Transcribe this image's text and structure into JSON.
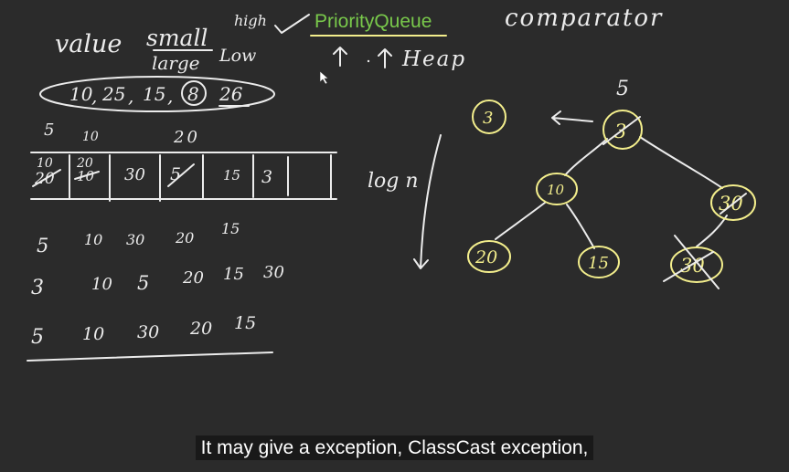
{
  "top": {
    "value": "value",
    "small": "small",
    "high": "high",
    "large": "large",
    "low": "Low",
    "priority_queue": "PriorityQueue",
    "comparator": "comparator",
    "heap": "Heap"
  },
  "sequence": {
    "a": "10",
    "b": "25",
    "c": "15",
    "d": "8",
    "e": "26"
  },
  "array_header": [
    "5",
    "10",
    "20"
  ],
  "array_cells": [
    {
      "top": "10",
      "bottom": "20"
    },
    {
      "top": "20",
      "bottom": "10"
    },
    {
      "top": "",
      "bottom": "30"
    },
    {
      "top": "",
      "bottom": "5"
    },
    {
      "top": "",
      "bottom": "15"
    },
    {
      "top": "",
      "bottom": "3"
    }
  ],
  "logn": "log n",
  "rows": [
    [
      "5",
      "10",
      "30",
      "20",
      "15"
    ],
    [
      "3",
      "10",
      "5",
      "20",
      "15",
      "30"
    ],
    [
      "5",
      "10",
      "30",
      "20",
      "15"
    ]
  ],
  "tree": {
    "top_label": "5",
    "detached": "3",
    "root": "3",
    "left": "10",
    "right": "30",
    "ll": "20",
    "lr": "15",
    "rl": "30"
  },
  "caption": "It may give a exception, ClassCast exception,"
}
